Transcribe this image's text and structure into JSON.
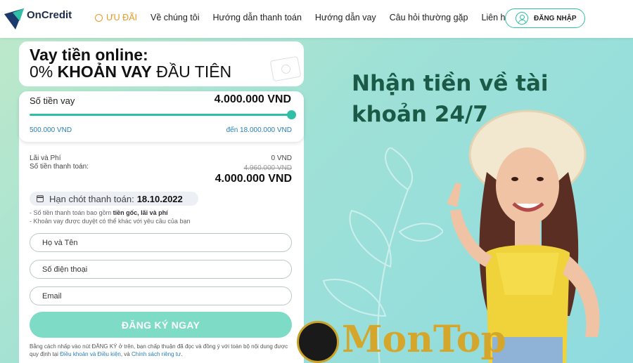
{
  "header": {
    "brand": "OnCredit",
    "nav": [
      "ƯU ĐÃI",
      "Về chúng tôi",
      "Hướng dẫn thanh toán",
      "Hướng dẫn vay",
      "Câu hỏi thường gặp",
      "Liên hệ"
    ],
    "login_label": "ĐĂNG NHẬP"
  },
  "promo": {
    "title_line1": "Vay tiền online:",
    "title_line2_a": "0% ",
    "title_line2_b": "KHOẢN VAY",
    "title_line2_c": " ĐẦU TIÊN"
  },
  "loan": {
    "amount_label": "Số tiền vay",
    "amount_value": "4.000.000  VND",
    "slider_fraction": 1.0,
    "min_label": "500.000 VND",
    "max_label": "đến 18.000.000 VND",
    "fee_label": "Lãi và Phí",
    "fee_value": "0 VND",
    "pay_label": "Số tiền thanh toán:",
    "pay_old": "4.960.000 VND",
    "pay_new": "4.000.000 VND",
    "deadline_label": "Hạn chót thanh toán:",
    "deadline_date": "18.10.2022",
    "note1_a": "- Số tiền thanh toán bao gồm ",
    "note1_b": "tiền gốc, lãi và phí",
    "note2": "- Khoản vay được duyệt có thể khác với yêu cầu của bạn"
  },
  "form": {
    "name_placeholder": "Họ và Tên",
    "phone_placeholder": "Số điện thoại",
    "email_placeholder": "Email",
    "submit_label": "ĐĂNG KÝ NGAY",
    "terms_a": "Bằng cách nhấp vào nút ĐĂNG KÝ ở trên, bạn chấp thuận đã đọc và đồng ý với toàn bộ nội dung được quy định tại ",
    "terms_link1": "Điều khoản và Điều kiện",
    "terms_b": ", và ",
    "terms_link2": "Chính sách riêng tư",
    "terms_c": "."
  },
  "hero": {
    "line1": "Nhận tiền về tài",
    "line2": "khoản 24/7"
  },
  "watermark": {
    "text": "MonTop"
  },
  "colors": {
    "accent": "#2fbfa6",
    "promo": "#e89a2a",
    "headline": "#1a5a46"
  }
}
